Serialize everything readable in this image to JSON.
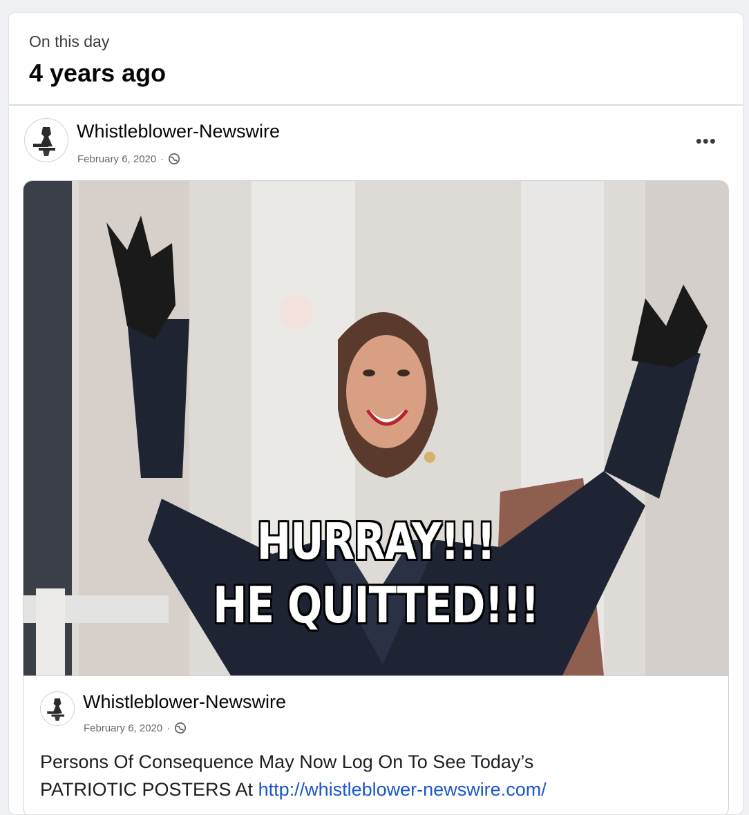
{
  "memory": {
    "label": "On this day",
    "title": "4 years ago"
  },
  "post": {
    "author": "Whistleblower-Newswire",
    "date": "February 6, 2020",
    "separator": "·",
    "more_label": "•••",
    "privacy_icon": "globe-icon"
  },
  "image": {
    "caption_line1": "HURRAY!!!",
    "caption_line2": "HE QUITTED!!!"
  },
  "shared": {
    "author": "Whistleblower-Newswire",
    "date": "February 6, 2020",
    "separator": "·",
    "text_line1": "Persons Of Consequence May Now Log On To See Today’s",
    "text_line2_prefix": "PATRIOTIC POSTERS At ",
    "link": "http://whistleblower-newswire.com/"
  },
  "colors": {
    "link": "#1a56c9",
    "coat": "#1e2434"
  }
}
